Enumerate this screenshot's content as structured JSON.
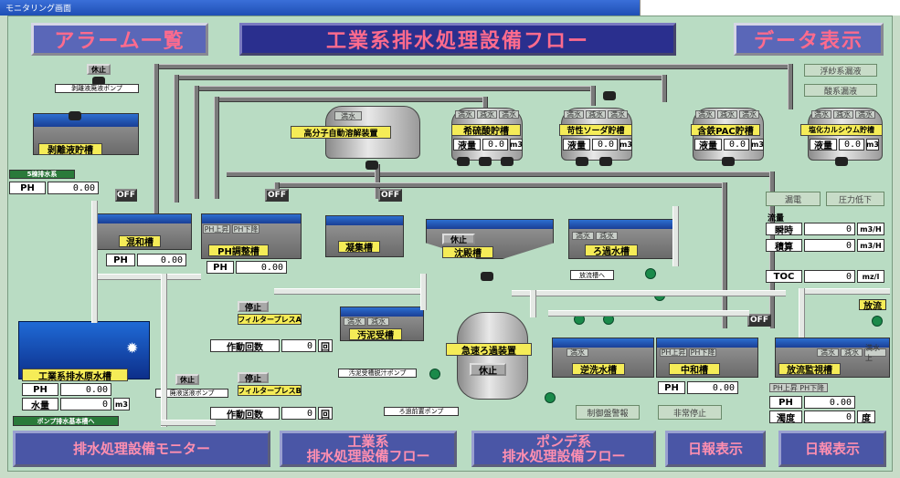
{
  "window": {
    "title": "モニタリング画面"
  },
  "header": {
    "alarm_list": "アラーム一覧",
    "page_title": "工業系排水処理設備フロー",
    "data_display": "データ表示"
  },
  "status_flags": {
    "suspension_system": "浮紗系漏液",
    "acid_system": "酸系漏液",
    "leak": "漏電",
    "pressure_drop": "圧力低下",
    "control_alarm": "制御盤警報",
    "emergency_stop": "非常停止"
  },
  "flow": {
    "label": "流量",
    "instant_label": "瞬時",
    "instant_value": "0",
    "instant_unit": "m3/H",
    "total_label": "積算",
    "total_value": "0",
    "total_unit": "m3/H",
    "toc_label": "TOC",
    "toc_value": "0",
    "toc_unit": "mz/l"
  },
  "tanks": {
    "stripping_liquid": {
      "label": "剥離液貯槽",
      "pump_status": "休止",
      "pump_label": "剥離液廃液ポンプ"
    },
    "polymer": {
      "label": "高分子自動溶解装置",
      "status": "満水"
    },
    "sulfuric": {
      "label": "希硫酸貯槽",
      "level_label": "液量",
      "level_value": "0.0",
      "unit": "m3",
      "lamps": [
        "満水",
        "減水",
        "満水"
      ]
    },
    "caustic": {
      "label": "苛性ソーダ貯槽",
      "level_label": "液量",
      "level_value": "0.0",
      "unit": "m3",
      "lamps": [
        "満水",
        "減水",
        "満水"
      ]
    },
    "pac": {
      "label": "含鉄PAC貯槽",
      "level_label": "液量",
      "level_value": "0.0",
      "unit": "m3",
      "lamps": [
        "満水",
        "減水",
        "満水"
      ]
    },
    "calcium": {
      "label": "塩化カルシウム貯槽",
      "level_label": "液量",
      "level_value": "0.0",
      "unit": "m3",
      "lamps": [
        "満水",
        "減水",
        "満水"
      ]
    },
    "mixing": {
      "label": "混和槽",
      "ph_label": "PH",
      "ph_value": "0.00",
      "off": "OFF"
    },
    "ph_adjust": {
      "label": "PH調整槽",
      "ph_label": "PH",
      "ph_value": "0.00",
      "off": "OFF",
      "lamps": [
        "PH上昇",
        "PH下降"
      ]
    },
    "coagulation": {
      "label": "凝集槽",
      "off": "OFF"
    },
    "settling": {
      "label": "沈殿槽",
      "status": "休止"
    },
    "filtrate": {
      "label": "ろ過水槽",
      "lamps": [
        "満水",
        "減水"
      ],
      "to_release": "放流槽へ"
    },
    "sludge_receive": {
      "label": "汚泥受槽",
      "lamps": [
        "満水",
        "減水"
      ],
      "pump_label": "汚泥受槽脱汁ポンプ"
    },
    "filter_press_a": {
      "status": "停止",
      "label": "フィルタープレスA",
      "count_label": "作動回数",
      "count_value": "0",
      "count_unit": "回"
    },
    "filter_press_b": {
      "status": "停止",
      "label": "フィルタープレスB",
      "count_label": "作動回数",
      "count_value": "0",
      "count_unit": "回"
    },
    "raw_water": {
      "label": "工業系排水原水槽",
      "ph_label": "PH",
      "ph_value": "0.00",
      "level_label": "水量",
      "level_value": "0",
      "unit": "m3",
      "pump_label": "廃液送液ポンプ",
      "pump_status": "休止",
      "to_label": "ポンプ排水基本槽へ",
      "inflow_label": "5棟排水系"
    },
    "rapid_filter": {
      "label": "急速ろ過装置",
      "status": "休止",
      "pump_label": "ろ過前置ポンプ"
    },
    "backwash": {
      "label": "逆洗水槽",
      "lamps": [
        "満水"
      ]
    },
    "neutralize": {
      "label": "中和槽",
      "ph_label": "PH",
      "ph_value": "0.00",
      "lamps": [
        "PH上昇",
        "PH下降"
      ]
    },
    "discharge": {
      "label": "放流監視槽",
      "off": "OFF",
      "release": "放流",
      "ph_label": "PH",
      "ph_value": "0.00",
      "turbidity_label": "濁度",
      "turbidity_value": "0",
      "turbidity_unit": "度",
      "lamps": [
        "満水",
        "減水",
        "満水上"
      ],
      "ph_lamps": "PH上昇 PH下降"
    }
  },
  "left_inflow": {
    "ph_label": "PH",
    "ph_value": "0.00"
  },
  "footer": {
    "monitor": "排水処理設備モニター",
    "industrial_line1": "工業系",
    "industrial_line2": "排水処理設備フロー",
    "pond_line1": "ポンデ系",
    "pond_line2": "排水処理設備フロー",
    "daily": "日報表示",
    "monthly": "日報表示"
  }
}
